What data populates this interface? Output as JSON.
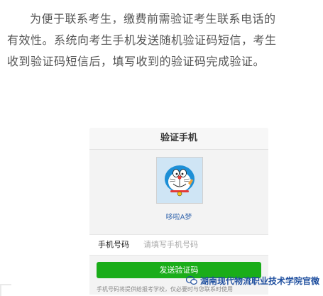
{
  "article": {
    "line1": "为便于联系考生，缴费前需验证考生联系电话的",
    "line2": "有效性。系统向考生手机发送随机验证码短信，考生",
    "line3": "收到验证码短信后，填写收到的验证码完成验证。"
  },
  "screen": {
    "title": "验证手机",
    "nickname": "哆啦A梦",
    "phone_label": "手机号码",
    "phone_placeholder": "请填写手机号码",
    "send_button": "发送验证码",
    "hint": "手机号码将提供给报考学校，仅必要时与您联系时使用"
  },
  "watermark": {
    "text": "湖南现代物流职业技术学院官微"
  },
  "colors": {
    "primary_button": "#1aad19",
    "nickname_link": "#3b6bb0"
  }
}
